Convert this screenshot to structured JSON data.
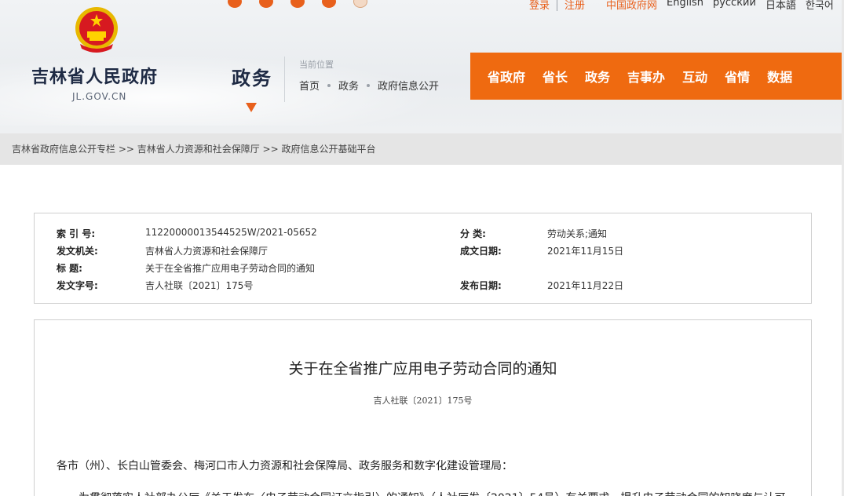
{
  "header": {
    "site_title": "吉林省人民政府",
    "site_domain": "JL.GOV.CN",
    "section": "政务",
    "location_label": "当前位置",
    "location_crumbs": [
      "首页",
      "政务",
      "政府信息公开"
    ],
    "login": "登录",
    "register": "注册",
    "languages": [
      "中国政府网",
      "English",
      "русский",
      "日本語",
      "한국어"
    ],
    "nav": [
      "省政府",
      "省长",
      "政务",
      "吉事办",
      "互动",
      "省情",
      "数据"
    ]
  },
  "path_bar": "吉林省政府信息公开专栏 >> 吉林省人力资源和社会保障厅 >> 政府信息公开基础平台",
  "meta": {
    "index_label": "索  引  号:",
    "index_value": "11220000013544525W/2021-05652",
    "category_label": "分      类:",
    "category_value": "劳动关系;通知",
    "issuer_label": "发文机关:",
    "issuer_value": "吉林省人力资源和社会保障厅",
    "date_label": "成文日期:",
    "date_value": "2021年11月15日",
    "title_label": "标      题:",
    "title_value": "关于在全省推广应用电子劳动合同的通知",
    "docno_label": "发文字号:",
    "docno_value": "吉人社联〔2021〕175号",
    "publish_label": "发布日期:",
    "publish_value": "2021年11月22日"
  },
  "article": {
    "title": "关于在全省推广应用电子劳动合同的通知",
    "doc_no": "吉人社联〔2021〕175号",
    "salutation": "各市（州）、长白山管委会、梅河口市人力资源和社会保障局、政务服务和数字化建设管理局：",
    "para1": "为贯彻落实人社部办公厅《关于发布〈电子劳动合同订立指引〉的通知》（人社厅发〔2021〕54号）有关要求，提升电子劳动合同的知晓度与认可"
  },
  "colors": {
    "accent": "#ef6a10",
    "path_bar_bg": "#e5e5e5"
  }
}
